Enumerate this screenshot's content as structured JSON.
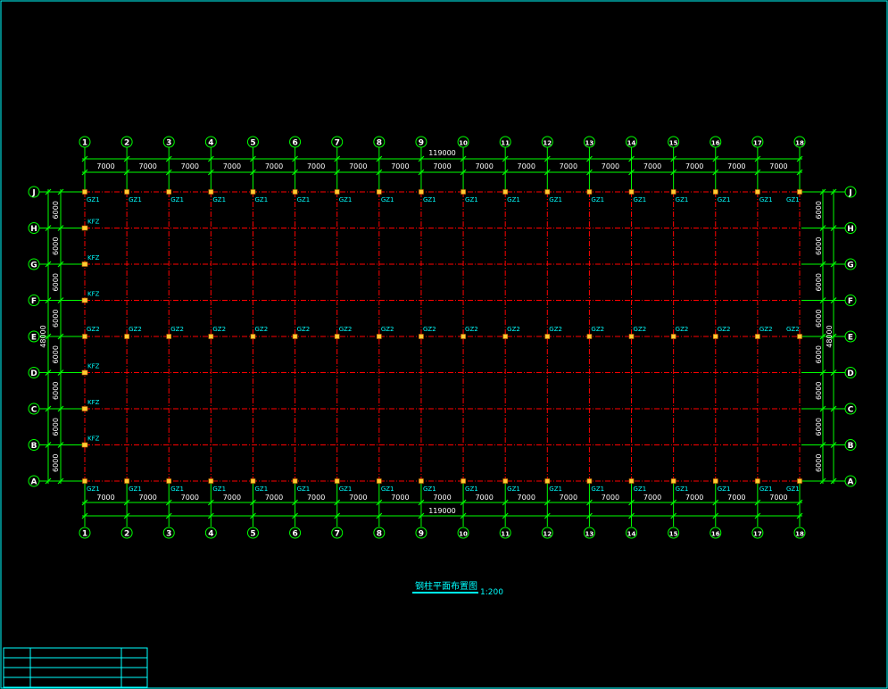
{
  "colors": {
    "background": "#000000",
    "frame": "#00ffff",
    "grid_line": "#ff0000",
    "dimension": "#00ff00",
    "label": "#00ffff",
    "bubble": "#00ff00",
    "column": "#ffcc33",
    "dim_text": "#ffffff"
  },
  "grid": {
    "x_labels": [
      "1",
      "2",
      "3",
      "4",
      "5",
      "6",
      "7",
      "8",
      "9",
      "10",
      "11",
      "12",
      "13",
      "14",
      "15",
      "16",
      "17",
      "18"
    ],
    "y_labels": [
      "J",
      "H",
      "G",
      "F",
      "E",
      "D",
      "C",
      "B",
      "A"
    ],
    "x_spacing_text": [
      "7000",
      "7000",
      "7000",
      "7000",
      "7000",
      "7000",
      "7000",
      "7000",
      "7000",
      "7000",
      "7000",
      "7000",
      "7000",
      "7000",
      "7000",
      "7000",
      "7000"
    ],
    "y_spacing_text": [
      "6000",
      "6000",
      "6000",
      "6000",
      "6000",
      "6000",
      "6000",
      "6000"
    ],
    "x_total_text": "119000",
    "y_total_text": "48000"
  },
  "columns": {
    "top_row": "GZ1",
    "middle_row": "GZ2",
    "bottom_row": "GZ1",
    "wind_column": "KFZ"
  },
  "title": {
    "text": "钢柱平面布置图",
    "scale": "1:200"
  }
}
